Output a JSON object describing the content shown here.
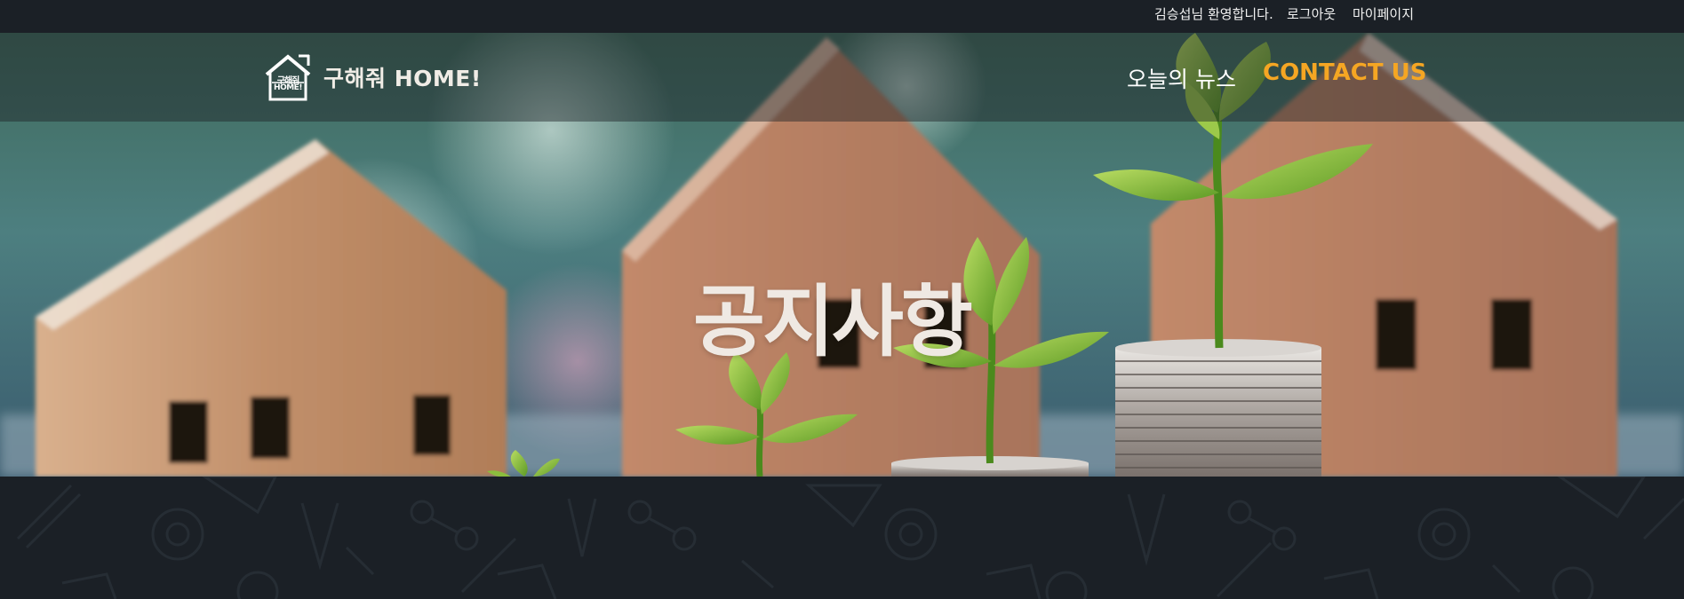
{
  "topbar": {
    "welcome": "김승섭님 환영합니다.",
    "logout": "로그아웃",
    "mypage": "마이페이지"
  },
  "nav": {
    "logo": {
      "icon": "house-logo-icon",
      "mark_line1": "구해줘",
      "mark_line2": "HOME!",
      "text": "구해줘 HOME!"
    },
    "menu": {
      "news": "오늘의 뉴스",
      "contact": "CONTACT US"
    }
  },
  "hero": {
    "title": "공지사항",
    "image": "wooden-houses-and-coin-plants-image"
  },
  "colors": {
    "dark_bg": "#1b2026",
    "accent": "#f5a623",
    "nav_text": "#ffffff"
  }
}
